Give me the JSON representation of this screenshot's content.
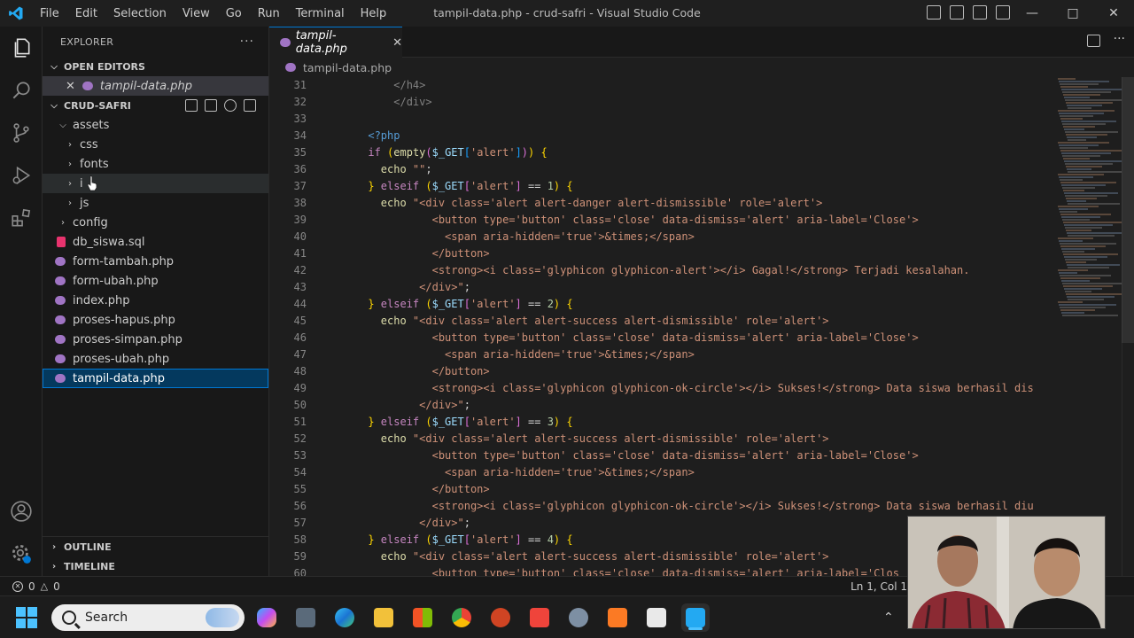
{
  "window": {
    "title": "tampil-data.php - crud-safri - Visual Studio Code",
    "menu": [
      "File",
      "Edit",
      "Selection",
      "View",
      "Go",
      "Run",
      "Terminal",
      "Help"
    ]
  },
  "sidebar": {
    "header": "EXPLORER",
    "open_editors_label": "OPEN EDITORS",
    "open_file": "tampil-data.php",
    "project_label": "CRUD-SAFRI",
    "tree": [
      {
        "label": "assets",
        "kind": "folder-open",
        "depth": 1
      },
      {
        "label": "css",
        "kind": "folder",
        "depth": 2
      },
      {
        "label": "fonts",
        "kind": "folder",
        "depth": 2
      },
      {
        "label": "i",
        "kind": "folder",
        "depth": 2
      },
      {
        "label": "js",
        "kind": "folder",
        "depth": 2
      },
      {
        "label": "config",
        "kind": "folder",
        "depth": 1
      },
      {
        "label": "db_siswa.sql",
        "kind": "sql",
        "depth": 1
      },
      {
        "label": "form-tambah.php",
        "kind": "php",
        "depth": 1
      },
      {
        "label": "form-ubah.php",
        "kind": "php",
        "depth": 1
      },
      {
        "label": "index.php",
        "kind": "php",
        "depth": 1
      },
      {
        "label": "proses-hapus.php",
        "kind": "php",
        "depth": 1
      },
      {
        "label": "proses-simpan.php",
        "kind": "php",
        "depth": 1
      },
      {
        "label": "proses-ubah.php",
        "kind": "php",
        "depth": 1
      },
      {
        "label": "tampil-data.php",
        "kind": "php",
        "depth": 1
      }
    ],
    "outline_label": "OUTLINE",
    "timeline_label": "TIMELINE"
  },
  "editor": {
    "tab_label": "tampil-data.php",
    "breadcrumb": "tampil-data.php",
    "line_numbers": [
      "31",
      "32",
      "33",
      "34",
      "35",
      "36",
      "37",
      "38",
      "39",
      "40",
      "41",
      "42",
      "43",
      "44",
      "45",
      "46",
      "47",
      "48",
      "49",
      "50",
      "51",
      "52",
      "53",
      "54",
      "55",
      "56",
      "57",
      "58",
      "59",
      "60"
    ],
    "lines": [
      [
        {
          "t": "          </h4>",
          "c": "#808080"
        }
      ],
      [
        {
          "t": "          </div>",
          "c": "#808080"
        }
      ],
      [
        {
          "t": "",
          "c": "#d4d4d4"
        }
      ],
      [
        {
          "t": "      <?php",
          "c": "#569cd6"
        }
      ],
      [
        {
          "t": "      if ",
          "c": "#c586c0"
        },
        {
          "t": "(",
          "c": "#ffd700"
        },
        {
          "t": "empty",
          "c": "#dcdcaa"
        },
        {
          "t": "(",
          "c": "#da70d6"
        },
        {
          "t": "$_GET",
          "c": "#9cdcfe"
        },
        {
          "t": "[",
          "c": "#179fff"
        },
        {
          "t": "'alert'",
          "c": "#ce9178"
        },
        {
          "t": "]",
          "c": "#179fff"
        },
        {
          "t": ")",
          "c": "#da70d6"
        },
        {
          "t": ")",
          "c": "#ffd700"
        },
        {
          "t": " {",
          "c": "#ffd700"
        }
      ],
      [
        {
          "t": "        echo ",
          "c": "#dcdcaa"
        },
        {
          "t": "\"\"",
          "c": "#ce9178"
        },
        {
          "t": ";",
          "c": "#d4d4d4"
        }
      ],
      [
        {
          "t": "      } ",
          "c": "#ffd700"
        },
        {
          "t": "elseif ",
          "c": "#c586c0"
        },
        {
          "t": "(",
          "c": "#ffd700"
        },
        {
          "t": "$_GET",
          "c": "#9cdcfe"
        },
        {
          "t": "[",
          "c": "#da70d6"
        },
        {
          "t": "'alert'",
          "c": "#ce9178"
        },
        {
          "t": "]",
          "c": "#da70d6"
        },
        {
          "t": " == ",
          "c": "#d4d4d4"
        },
        {
          "t": "1",
          "c": "#b5cea8"
        },
        {
          "t": ")",
          "c": "#ffd700"
        },
        {
          "t": " {",
          "c": "#ffd700"
        }
      ],
      [
        {
          "t": "        echo ",
          "c": "#dcdcaa"
        },
        {
          "t": "\"<div class='alert alert-danger alert-dismissible' role='alert'>",
          "c": "#ce9178"
        }
      ],
      [
        {
          "t": "                <button type='button' class='close' data-dismiss='alert' aria-label='Close'>",
          "c": "#ce9178"
        }
      ],
      [
        {
          "t": "                  <span aria-hidden='true'>&times;</span>",
          "c": "#ce9178"
        }
      ],
      [
        {
          "t": "                </button>",
          "c": "#ce9178"
        }
      ],
      [
        {
          "t": "                <strong><i class='glyphicon glyphicon-alert'></i> Gagal!</strong> Terjadi kesalahan.",
          "c": "#ce9178"
        }
      ],
      [
        {
          "t": "              </div>\"",
          "c": "#ce9178"
        },
        {
          "t": ";",
          "c": "#d4d4d4"
        }
      ],
      [
        {
          "t": "      } ",
          "c": "#ffd700"
        },
        {
          "t": "elseif ",
          "c": "#c586c0"
        },
        {
          "t": "(",
          "c": "#ffd700"
        },
        {
          "t": "$_GET",
          "c": "#9cdcfe"
        },
        {
          "t": "[",
          "c": "#da70d6"
        },
        {
          "t": "'alert'",
          "c": "#ce9178"
        },
        {
          "t": "]",
          "c": "#da70d6"
        },
        {
          "t": " == ",
          "c": "#d4d4d4"
        },
        {
          "t": "2",
          "c": "#b5cea8"
        },
        {
          "t": ")",
          "c": "#ffd700"
        },
        {
          "t": " {",
          "c": "#ffd700"
        }
      ],
      [
        {
          "t": "        echo ",
          "c": "#dcdcaa"
        },
        {
          "t": "\"<div class='alert alert-success alert-dismissible' role='alert'>",
          "c": "#ce9178"
        }
      ],
      [
        {
          "t": "                <button type='button' class='close' data-dismiss='alert' aria-label='Close'>",
          "c": "#ce9178"
        }
      ],
      [
        {
          "t": "                  <span aria-hidden='true'>&times;</span>",
          "c": "#ce9178"
        }
      ],
      [
        {
          "t": "                </button>",
          "c": "#ce9178"
        }
      ],
      [
        {
          "t": "                <strong><i class='glyphicon glyphicon-ok-circle'></i> Sukses!</strong> Data siswa berhasil dis",
          "c": "#ce9178"
        }
      ],
      [
        {
          "t": "              </div>\"",
          "c": "#ce9178"
        },
        {
          "t": ";",
          "c": "#d4d4d4"
        }
      ],
      [
        {
          "t": "      } ",
          "c": "#ffd700"
        },
        {
          "t": "elseif ",
          "c": "#c586c0"
        },
        {
          "t": "(",
          "c": "#ffd700"
        },
        {
          "t": "$_GET",
          "c": "#9cdcfe"
        },
        {
          "t": "[",
          "c": "#da70d6"
        },
        {
          "t": "'alert'",
          "c": "#ce9178"
        },
        {
          "t": "]",
          "c": "#da70d6"
        },
        {
          "t": " == ",
          "c": "#d4d4d4"
        },
        {
          "t": "3",
          "c": "#b5cea8"
        },
        {
          "t": ")",
          "c": "#ffd700"
        },
        {
          "t": " {",
          "c": "#ffd700"
        }
      ],
      [
        {
          "t": "        echo ",
          "c": "#dcdcaa"
        },
        {
          "t": "\"<div class='alert alert-success alert-dismissible' role='alert'>",
          "c": "#ce9178"
        }
      ],
      [
        {
          "t": "                <button type='button' class='close' data-dismiss='alert' aria-label='Close'>",
          "c": "#ce9178"
        }
      ],
      [
        {
          "t": "                  <span aria-hidden='true'>&times;</span>",
          "c": "#ce9178"
        }
      ],
      [
        {
          "t": "                </button>",
          "c": "#ce9178"
        }
      ],
      [
        {
          "t": "                <strong><i class='glyphicon glyphicon-ok-circle'></i> Sukses!</strong> Data siswa berhasil diu",
          "c": "#ce9178"
        }
      ],
      [
        {
          "t": "              </div>\"",
          "c": "#ce9178"
        },
        {
          "t": ";",
          "c": "#d4d4d4"
        }
      ],
      [
        {
          "t": "      } ",
          "c": "#ffd700"
        },
        {
          "t": "elseif ",
          "c": "#c586c0"
        },
        {
          "t": "(",
          "c": "#ffd700"
        },
        {
          "t": "$_GET",
          "c": "#9cdcfe"
        },
        {
          "t": "[",
          "c": "#da70d6"
        },
        {
          "t": "'alert'",
          "c": "#ce9178"
        },
        {
          "t": "]",
          "c": "#da70d6"
        },
        {
          "t": " == ",
          "c": "#d4d4d4"
        },
        {
          "t": "4",
          "c": "#b5cea8"
        },
        {
          "t": ")",
          "c": "#ffd700"
        },
        {
          "t": " {",
          "c": "#ffd700"
        }
      ],
      [
        {
          "t": "        echo ",
          "c": "#dcdcaa"
        },
        {
          "t": "\"<div class='alert alert-success alert-dismissible' role='alert'>",
          "c": "#ce9178"
        }
      ],
      [
        {
          "t": "                <button type='button' class='close' data-dismiss='alert' aria-label='Clos",
          "c": "#ce9178"
        }
      ]
    ]
  },
  "statusbar": {
    "errors": "0",
    "warnings": "0",
    "cursor_position": "Ln 1, Col 1"
  },
  "taskbar": {
    "search_label": "Search",
    "apps": [
      "copilot-icon",
      "camera-icon",
      "edge-icon",
      "file-explorer-icon",
      "store-icon",
      "chrome-icon",
      "powerpoint-icon",
      "anydesk-icon",
      "settings-icon",
      "xampp-icon",
      "notepad-icon",
      "vscode-icon"
    ]
  },
  "colors": {
    "accent": "#0078d4",
    "php_icon": "#a074c4",
    "sql_icon": "#e8336e"
  }
}
